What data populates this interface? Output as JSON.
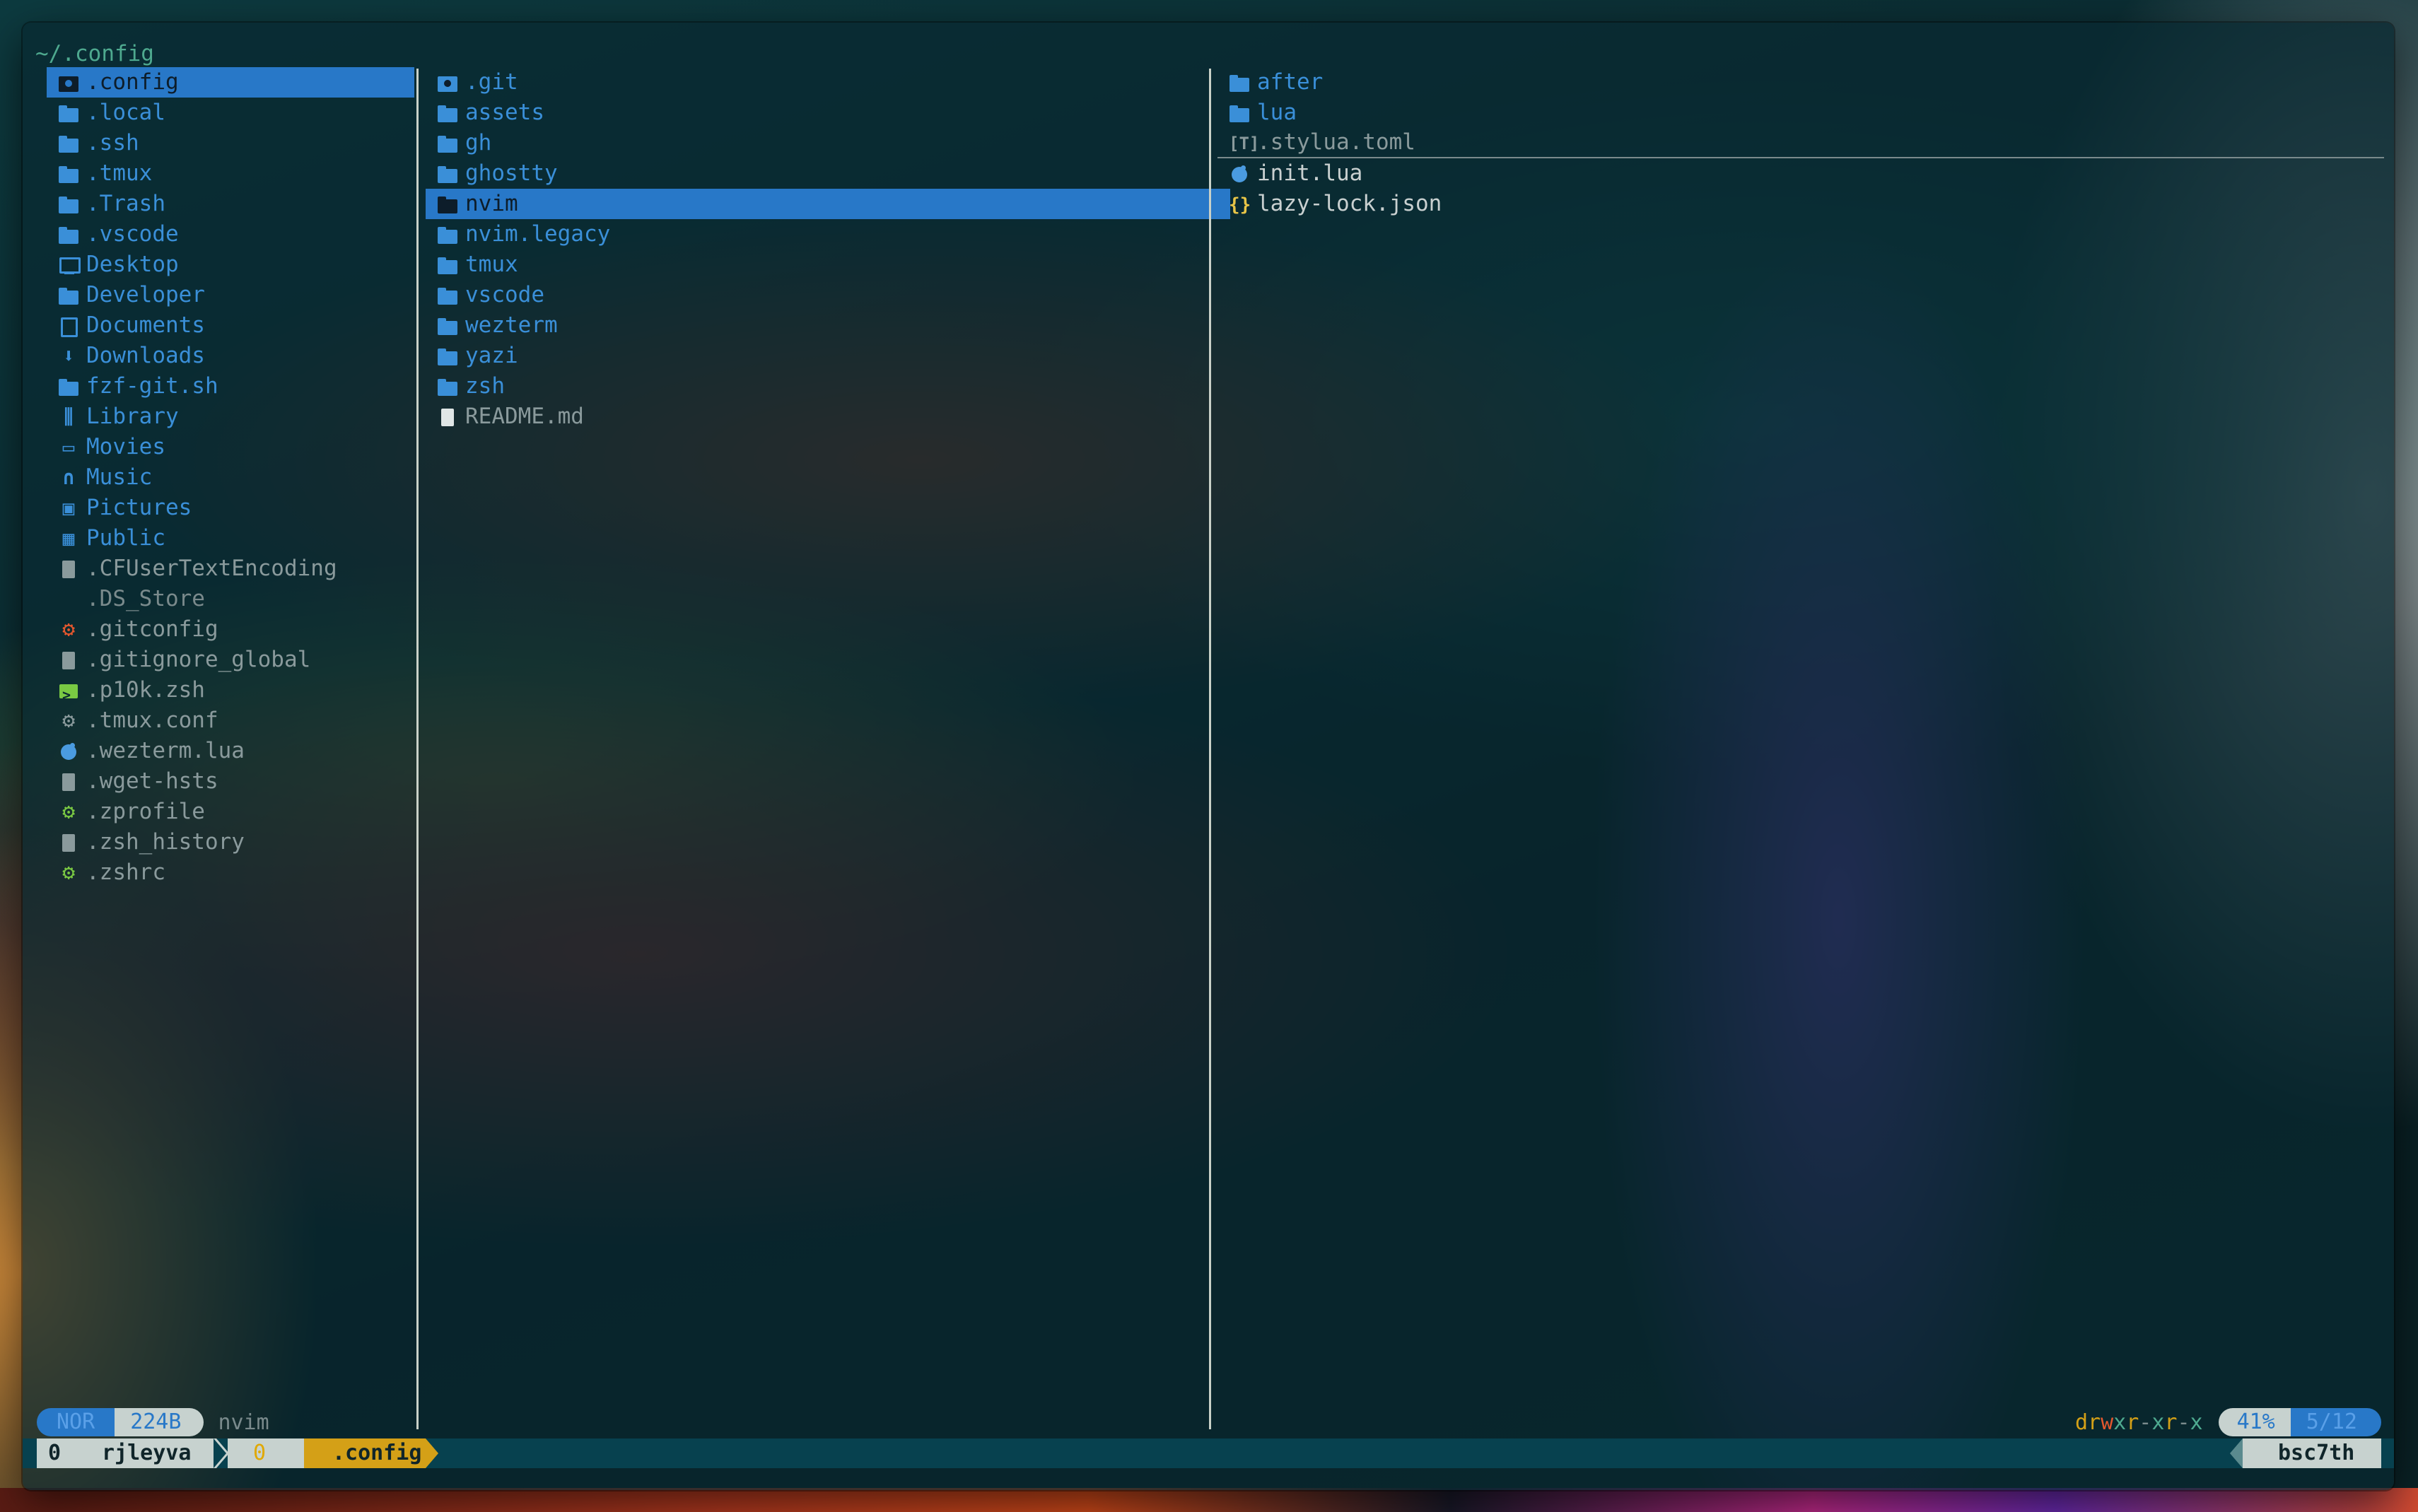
{
  "header": {
    "path": "~/.config"
  },
  "colors": {
    "directory": "#3a8fd8",
    "file": "#8a9a9c",
    "selection": "#2878c8",
    "accent_yellow": "#d4a017",
    "git_orange": "#e4572e",
    "config_green": "#7ac943"
  },
  "parent_column": {
    "items": [
      {
        "name": ".config",
        "icon": "gitfolder",
        "kind": "dir",
        "selected": true
      },
      {
        "name": ".local",
        "icon": "folder",
        "kind": "dir"
      },
      {
        "name": ".ssh",
        "icon": "folder",
        "kind": "dir"
      },
      {
        "name": ".tmux",
        "icon": "folder",
        "kind": "dir"
      },
      {
        "name": ".Trash",
        "icon": "folder",
        "kind": "dir"
      },
      {
        "name": ".vscode",
        "icon": "folder",
        "kind": "dir"
      },
      {
        "name": "Desktop",
        "icon": "monitor",
        "kind": "dir"
      },
      {
        "name": "Developer",
        "icon": "folder",
        "kind": "dir"
      },
      {
        "name": "Documents",
        "icon": "outline",
        "kind": "dir"
      },
      {
        "name": "Downloads",
        "icon": "download",
        "kind": "dir"
      },
      {
        "name": "fzf-git.sh",
        "icon": "folder",
        "kind": "dir"
      },
      {
        "name": "Library",
        "icon": "library",
        "kind": "dir"
      },
      {
        "name": "Movies",
        "icon": "video",
        "kind": "dir"
      },
      {
        "name": "Music",
        "icon": "headphones",
        "kind": "dir"
      },
      {
        "name": "Pictures",
        "icon": "picture",
        "kind": "dir"
      },
      {
        "name": "Public",
        "icon": "building",
        "kind": "dir"
      },
      {
        "name": ".CFUserTextEncoding",
        "icon": "doc",
        "kind": "file"
      },
      {
        "name": ".DS_Store",
        "icon": "none",
        "kind": "dim"
      },
      {
        "name": ".gitconfig",
        "icon": "gear-orange",
        "kind": "file"
      },
      {
        "name": ".gitignore_global",
        "icon": "doc",
        "kind": "file"
      },
      {
        "name": ".p10k.zsh",
        "icon": "terminal",
        "kind": "file"
      },
      {
        "name": ".tmux.conf",
        "icon": "gear-gray",
        "kind": "file"
      },
      {
        "name": ".wezterm.lua",
        "icon": "lua",
        "kind": "file"
      },
      {
        "name": ".wget-hsts",
        "icon": "doc",
        "kind": "file"
      },
      {
        "name": ".zprofile",
        "icon": "gear-green",
        "kind": "file"
      },
      {
        "name": ".zsh_history",
        "icon": "doc",
        "kind": "file"
      },
      {
        "name": ".zshrc",
        "icon": "gear-green",
        "kind": "file"
      }
    ]
  },
  "current_column": {
    "items": [
      {
        "name": ".git",
        "icon": "gitfolder",
        "kind": "dir"
      },
      {
        "name": "assets",
        "icon": "folder",
        "kind": "dir"
      },
      {
        "name": "gh",
        "icon": "folder",
        "kind": "dir"
      },
      {
        "name": "ghostty",
        "icon": "folder",
        "kind": "dir"
      },
      {
        "name": "nvim",
        "icon": "folder",
        "kind": "dir",
        "selected": true
      },
      {
        "name": "nvim.legacy",
        "icon": "folder",
        "kind": "dir"
      },
      {
        "name": "tmux",
        "icon": "folder",
        "kind": "dir"
      },
      {
        "name": "vscode",
        "icon": "folder",
        "kind": "dir"
      },
      {
        "name": "wezterm",
        "icon": "folder",
        "kind": "dir"
      },
      {
        "name": "yazi",
        "icon": "folder",
        "kind": "dir"
      },
      {
        "name": "zsh",
        "icon": "folder",
        "kind": "dir"
      },
      {
        "name": "README.md",
        "icon": "doc-white",
        "kind": "file"
      }
    ]
  },
  "preview_column": {
    "items": [
      {
        "name": "after",
        "icon": "folder",
        "kind": "dir"
      },
      {
        "name": "lua",
        "icon": "folder",
        "kind": "dir"
      },
      {
        "name": ".stylua.toml",
        "icon": "toml",
        "kind": "file",
        "underline": true
      },
      {
        "name": "init.lua",
        "icon": "lua",
        "kind": "white"
      },
      {
        "name": "lazy-lock.json",
        "icon": "json",
        "kind": "white"
      }
    ]
  },
  "status": {
    "mode": "NOR",
    "size": "224B",
    "name": "nvim",
    "permissions": [
      "d",
      "r",
      "w",
      "x",
      "r",
      "-",
      "x",
      "r",
      "-",
      "x"
    ],
    "percent": "41%",
    "position": "5/12"
  },
  "tabline": {
    "tab_index": "0",
    "user": "rjleyva",
    "count": "0",
    "dir": ".config",
    "host": "bsc7th"
  }
}
